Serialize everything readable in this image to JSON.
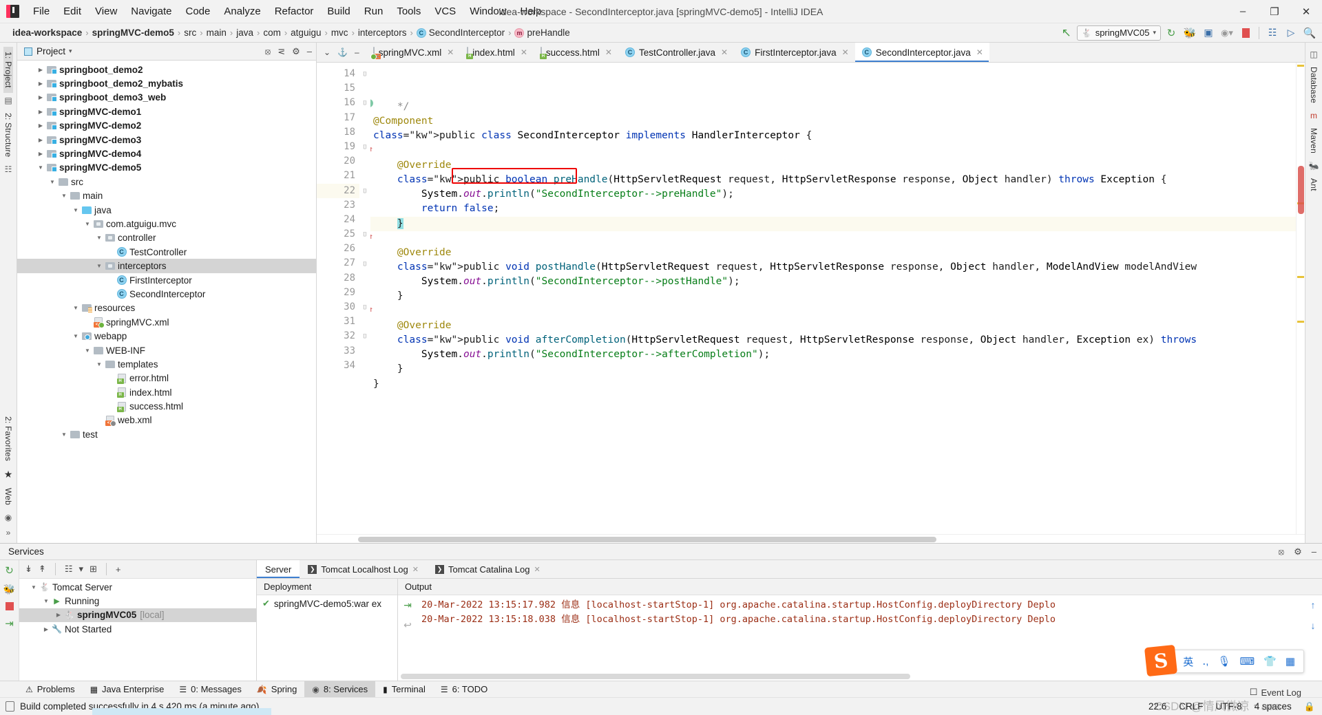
{
  "titlebar": {
    "menu": [
      "File",
      "Edit",
      "View",
      "Navigate",
      "Code",
      "Analyze",
      "Refactor",
      "Build",
      "Run",
      "Tools",
      "VCS",
      "Window",
      "Help"
    ],
    "window_title": "idea-workspace - SecondInterceptor.java [springMVC-demo5] - IntelliJ IDEA",
    "minimize": "–",
    "maximize": "❐",
    "close": "✕"
  },
  "breadcrumb": {
    "items": [
      "idea-workspace",
      "springMVC-demo5",
      "src",
      "main",
      "java",
      "com",
      "atguigu",
      "mvc",
      "interceptors"
    ],
    "class_item": "SecondInterceptor",
    "method_item": "preHandle",
    "class_badge": "C",
    "method_badge": "m",
    "separator": "›"
  },
  "toolbar": {
    "back_arrow": "↖",
    "run_config": "springMVC05",
    "run_config_caret": "▾",
    "icons": [
      "redeploy-icon",
      "debug-icon",
      "coverage-icon",
      "profiler-icon",
      "stop-icon",
      "build-icon",
      "run-tomcat-icon",
      "search-everywhere-icon"
    ],
    "stop_label": "■"
  },
  "left_rail": {
    "project_label": "1: Project",
    "structure_label": "2: Structure",
    "favorites_label": "2: Favorites",
    "web_label": "Web",
    "star_icon": "★"
  },
  "right_rail": {
    "database_label": "Database",
    "maven_label": "Maven",
    "ant_label": "Ant"
  },
  "project_panel": {
    "title": "Project",
    "caret": "▾",
    "icons": [
      "locate-icon",
      "collapse-all-icon",
      "settings-icon",
      "hide-icon"
    ],
    "tree": [
      {
        "indent": 1,
        "twisty": "▶",
        "icon": "folder-module",
        "label": "springboot_demo2",
        "bold": true,
        "selected": false
      },
      {
        "indent": 1,
        "twisty": "▶",
        "icon": "folder-module",
        "label": "springboot_demo2_mybatis",
        "bold": true,
        "selected": false
      },
      {
        "indent": 1,
        "twisty": "▶",
        "icon": "folder-module",
        "label": "springboot_demo3_web",
        "bold": true,
        "selected": false
      },
      {
        "indent": 1,
        "twisty": "▶",
        "icon": "folder-module",
        "label": "springMVC-demo1",
        "bold": true,
        "selected": false
      },
      {
        "indent": 1,
        "twisty": "▶",
        "icon": "folder-module",
        "label": "springMVC-demo2",
        "bold": true,
        "selected": false
      },
      {
        "indent": 1,
        "twisty": "▶",
        "icon": "folder-module",
        "label": "springMVC-demo3",
        "bold": true,
        "selected": false
      },
      {
        "indent": 1,
        "twisty": "▶",
        "icon": "folder-module",
        "label": "springMVC-demo4",
        "bold": true,
        "selected": false
      },
      {
        "indent": 1,
        "twisty": "▼",
        "icon": "folder-module",
        "label": "springMVC-demo5",
        "bold": true,
        "selected": false
      },
      {
        "indent": 2,
        "twisty": "▼",
        "icon": "folder-plain",
        "label": "src",
        "bold": false,
        "selected": false
      },
      {
        "indent": 3,
        "twisty": "▼",
        "icon": "folder-plain",
        "label": "main",
        "bold": false,
        "selected": false
      },
      {
        "indent": 4,
        "twisty": "▼",
        "icon": "folder-source",
        "label": "java",
        "bold": false,
        "selected": false
      },
      {
        "indent": 5,
        "twisty": "▼",
        "icon": "folder-package",
        "label": "com.atguigu.mvc",
        "bold": false,
        "selected": false
      },
      {
        "indent": 6,
        "twisty": "▼",
        "icon": "folder-package",
        "label": "controller",
        "bold": false,
        "selected": false
      },
      {
        "indent": 7,
        "twisty": "",
        "icon": "java-class",
        "label": "TestController",
        "bold": false,
        "selected": false
      },
      {
        "indent": 6,
        "twisty": "▼",
        "icon": "folder-package",
        "label": "interceptors",
        "bold": false,
        "selected": true
      },
      {
        "indent": 7,
        "twisty": "",
        "icon": "java-class",
        "label": "FirstInterceptor",
        "bold": false,
        "selected": false
      },
      {
        "indent": 7,
        "twisty": "",
        "icon": "java-class",
        "label": "SecondInterceptor",
        "bold": false,
        "selected": false
      },
      {
        "indent": 4,
        "twisty": "▼",
        "icon": "folder-resources",
        "label": "resources",
        "bold": false,
        "selected": false
      },
      {
        "indent": 5,
        "twisty": "",
        "icon": "file-spring-xml",
        "label": "springMVC.xml",
        "bold": false,
        "selected": false
      },
      {
        "indent": 4,
        "twisty": "▼",
        "icon": "folder-web",
        "label": "webapp",
        "bold": false,
        "selected": false
      },
      {
        "indent": 5,
        "twisty": "▼",
        "icon": "folder-plain",
        "label": "WEB-INF",
        "bold": false,
        "selected": false
      },
      {
        "indent": 6,
        "twisty": "▼",
        "icon": "folder-plain",
        "label": "templates",
        "bold": false,
        "selected": false
      },
      {
        "indent": 7,
        "twisty": "",
        "icon": "file-html",
        "label": "error.html",
        "bold": false,
        "selected": false
      },
      {
        "indent": 7,
        "twisty": "",
        "icon": "file-html",
        "label": "index.html",
        "bold": false,
        "selected": false
      },
      {
        "indent": 7,
        "twisty": "",
        "icon": "file-html",
        "label": "success.html",
        "bold": false,
        "selected": false
      },
      {
        "indent": 6,
        "twisty": "",
        "icon": "file-xml",
        "label": "web.xml",
        "bold": false,
        "selected": false
      },
      {
        "indent": 3,
        "twisty": "▼",
        "icon": "folder-plain",
        "label": "test",
        "bold": false,
        "selected": false
      }
    ]
  },
  "editor": {
    "tabs": [
      {
        "label": "springMVC.xml",
        "icon": "xml-file-icon",
        "active": false,
        "close": "✕"
      },
      {
        "label": "index.html",
        "icon": "html-file-icon",
        "active": false,
        "close": "✕"
      },
      {
        "label": "success.html",
        "icon": "html-file-icon",
        "active": false,
        "close": "✕"
      },
      {
        "label": "TestController.java",
        "icon": "java-class-icon",
        "active": false,
        "close": "✕"
      },
      {
        "label": "FirstInterceptor.java",
        "icon": "java-class-icon",
        "active": false,
        "close": "✕"
      },
      {
        "label": "SecondInterceptor.java",
        "icon": "java-class-icon",
        "active": true,
        "close": "✕"
      }
    ],
    "first_line_number": 14,
    "lines": [
      {
        "n": 14,
        "text": "    */",
        "kind": "comment-tail",
        "hl": false
      },
      {
        "n": 15,
        "text": "@Component",
        "kind": "annotation",
        "hl": false
      },
      {
        "n": 16,
        "text": "public class SecondInterceptor implements HandlerInterceptor {",
        "kind": "class-decl",
        "hl": false,
        "gutter_icon": "implements-icon"
      },
      {
        "n": 17,
        "text": "",
        "kind": "blank",
        "hl": false
      },
      {
        "n": 18,
        "text": "    @Override",
        "kind": "annotation",
        "hl": false
      },
      {
        "n": 19,
        "text": "    public boolean preHandle(HttpServletRequest request, HttpServletResponse response, Object handler) throws Exception {",
        "kind": "method-decl",
        "hl": false,
        "gutter_icon": "override-icon"
      },
      {
        "n": 20,
        "text": "        System.out.println(\"SecondInterceptor-->preHandle\");",
        "kind": "stmt-print",
        "hl": false,
        "string": "\"SecondInterceptor-->preHandle\""
      },
      {
        "n": 21,
        "text": "        return false;",
        "kind": "return-stmt",
        "hl": false,
        "highlighted_box": true
      },
      {
        "n": 22,
        "text": "    }",
        "kind": "close-brace",
        "hl": true
      },
      {
        "n": 23,
        "text": "",
        "kind": "blank",
        "hl": false
      },
      {
        "n": 24,
        "text": "    @Override",
        "kind": "annotation",
        "hl": false
      },
      {
        "n": 25,
        "text": "    public void postHandle(HttpServletRequest request, HttpServletResponse response, Object handler, ModelAndView modelAndView",
        "kind": "method-decl",
        "hl": false,
        "gutter_icon": "override-icon"
      },
      {
        "n": 26,
        "text": "        System.out.println(\"SecondInterceptor-->postHandle\");",
        "kind": "stmt-print",
        "hl": false,
        "string": "\"SecondInterceptor-->postHandle\""
      },
      {
        "n": 27,
        "text": "    }",
        "kind": "close-brace",
        "hl": false
      },
      {
        "n": 28,
        "text": "",
        "kind": "blank",
        "hl": false
      },
      {
        "n": 29,
        "text": "    @Override",
        "kind": "annotation",
        "hl": false
      },
      {
        "n": 30,
        "text": "    public void afterCompletion(HttpServletRequest request, HttpServletResponse response, Object handler, Exception ex) throws",
        "kind": "method-decl",
        "hl": false,
        "gutter_icon": "override-icon"
      },
      {
        "n": 31,
        "text": "        System.out.println(\"SecondInterceptor-->afterCompletion\");",
        "kind": "stmt-print",
        "hl": false,
        "string": "\"SecondInterceptor-->afterCompletion\""
      },
      {
        "n": 32,
        "text": "    }",
        "kind": "close-brace",
        "hl": false
      },
      {
        "n": 33,
        "text": "}",
        "kind": "close-brace",
        "hl": false
      },
      {
        "n": 34,
        "text": "",
        "kind": "blank",
        "hl": false
      }
    ]
  },
  "services": {
    "title": "Services",
    "header_icons": [
      "help-icon",
      "settings-icon",
      "hide-icon"
    ],
    "action_icons": [
      "rerun-icon",
      "debug-icon",
      "stop-icon",
      "redeploy-icon"
    ],
    "toolbar_icons": [
      "expand-all-icon",
      "collapse-all-icon",
      "group-icon",
      "filter-icon",
      "add-tab-icon",
      "add-icon"
    ],
    "tree": [
      {
        "indent": 0,
        "twisty": "▼",
        "icon": "tomcat-icon",
        "label": "Tomcat Server",
        "suffix": "",
        "bold": false,
        "selected": false
      },
      {
        "indent": 1,
        "twisty": "▼",
        "icon": "running-icon",
        "label": "Running",
        "suffix": "",
        "bold": false,
        "selected": false
      },
      {
        "indent": 2,
        "twisty": "▶",
        "icon": "tomcat-run-icon",
        "label": "springMVC05",
        "suffix": "[local]",
        "bold": true,
        "selected": true
      },
      {
        "indent": 1,
        "twisty": "▶",
        "icon": "wrench-icon",
        "label": "Not Started",
        "suffix": "",
        "bold": false,
        "selected": false
      }
    ],
    "tabs": [
      {
        "label": "Server",
        "icon": "",
        "active": true,
        "close": ""
      },
      {
        "label": "Tomcat Localhost Log",
        "icon": "console-icon",
        "active": false,
        "close": "✕"
      },
      {
        "label": "Tomcat Catalina Log",
        "icon": "console-icon",
        "active": false,
        "close": "✕"
      }
    ],
    "deployment_header": "Deployment",
    "deployment_item": "springMVC-demo5:war ex",
    "deployment_check": "✔",
    "output_header": "Output",
    "log_lines": [
      "20-Mar-2022 13:15:17.982 信息 [localhost-startStop-1] org.apache.catalina.startup.HostConfig.deployDirectory Deplo",
      "20-Mar-2022 13:15:18.038 信息 [localhost-startStop-1] org.apache.catalina.startup.HostConfig.deployDirectory Deplo"
    ],
    "scroll_icons": [
      "scroll-up-icon",
      "scroll-down-icon"
    ]
  },
  "tool_window_bar": {
    "items": [
      {
        "label": "Problems",
        "icon": "warning-icon",
        "mnemonic": "",
        "active": false
      },
      {
        "label": "Java Enterprise",
        "icon": "java-ee-icon",
        "mnemonic": "",
        "active": false
      },
      {
        "label": "0: Messages",
        "icon": "messages-icon",
        "mnemonic": "0",
        "active": false
      },
      {
        "label": "Spring",
        "icon": "spring-leaf-icon",
        "mnemonic": "",
        "active": false
      },
      {
        "label": "8: Services",
        "icon": "services-icon",
        "mnemonic": "8",
        "active": true
      },
      {
        "label": "Terminal",
        "icon": "terminal-icon",
        "mnemonic": "",
        "active": false
      },
      {
        "label": "6: TODO",
        "icon": "todo-icon",
        "mnemonic": "6",
        "active": false
      }
    ]
  },
  "statusbar": {
    "build_icon": "build-status-icon",
    "message": "Build completed successfully in 4 s 420 ms (a minute ago)",
    "caret_position": "22:6",
    "line_separator": "CRLF",
    "encoding": "UTF-8",
    "indent": "4 spaces",
    "lock_icon": "ὑ2",
    "event_log": "Event Log"
  },
  "ime": {
    "logo": "S",
    "mode": "英",
    "items": [
      "punctuation-icon",
      "microphone-icon",
      "keyboard-icon",
      "skin-icon",
      "apps-icon"
    ]
  },
  "watermark": "CSDN @情风微凉‧aaa",
  "colors": {
    "accent": "#3d7fd0",
    "keyword": "#0033b3",
    "string": "#067d17",
    "annotation": "#9e880d",
    "method": "#00627a",
    "field": "#871094",
    "error_box": "#ee0000",
    "log_text": "#9b2d14",
    "selection": "#d4d4d4",
    "current_line": "#fcfaef"
  }
}
